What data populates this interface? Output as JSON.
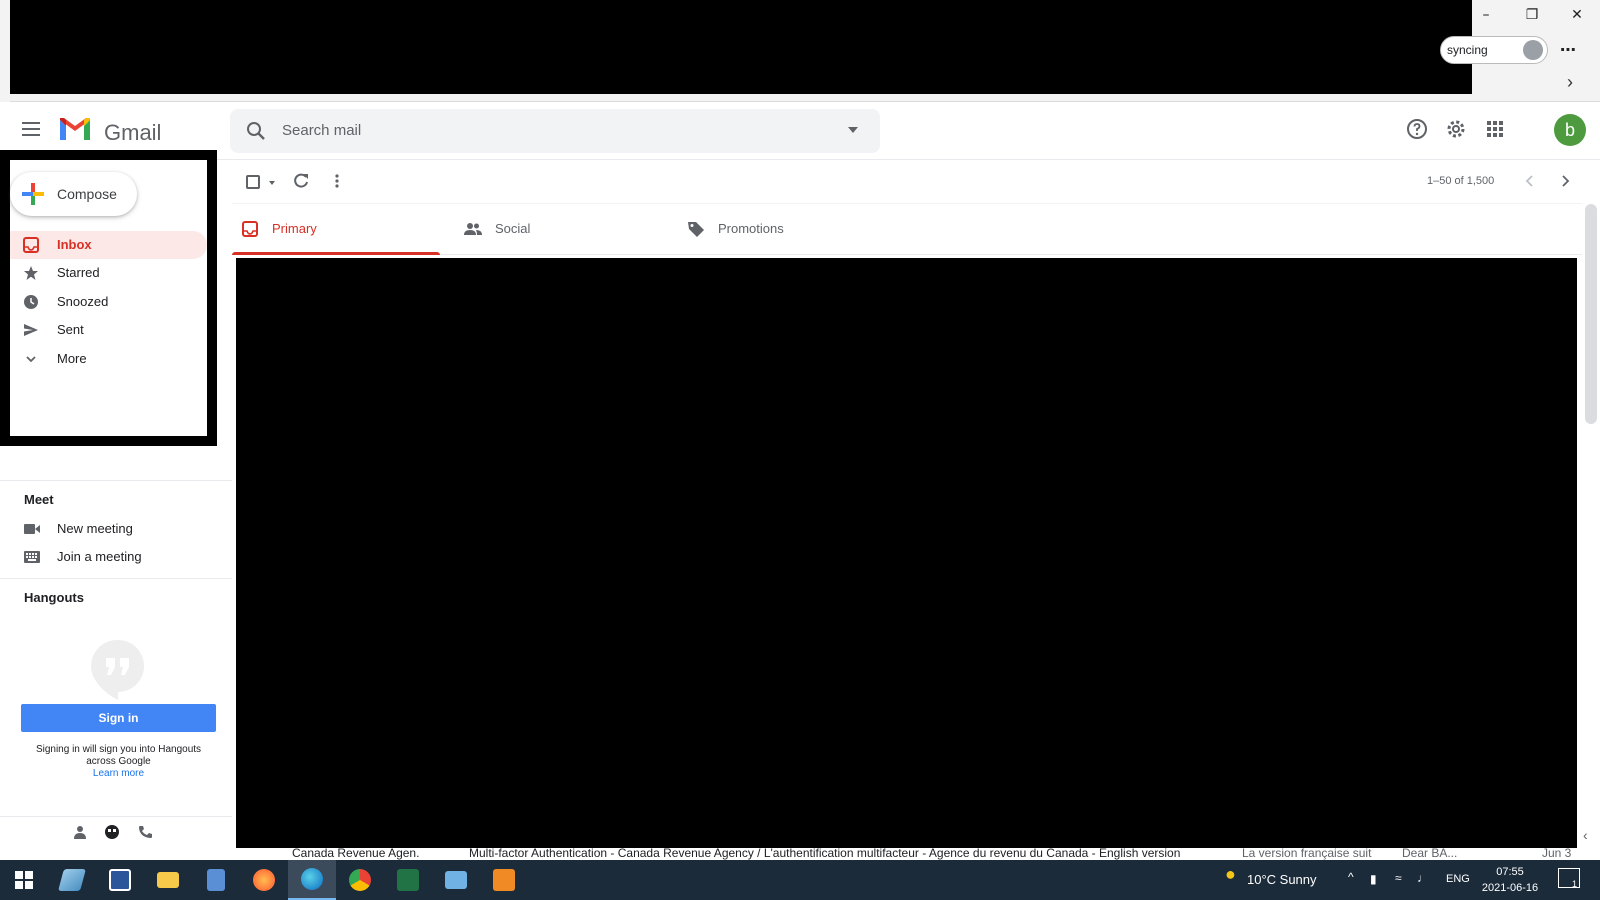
{
  "browser": {
    "sync_label": "syncing",
    "menu_dots": "⋯",
    "next_arrow": "›",
    "window_controls": [
      "–",
      "❐",
      "✕"
    ]
  },
  "header": {
    "app_name": "Gmail",
    "search_placeholder": "Search mail",
    "avatar_letter": "b"
  },
  "nav": {
    "compose_label": "Compose",
    "items": [
      {
        "label": "Inbox",
        "icon": "inbox-icon",
        "active": true
      },
      {
        "label": "Starred",
        "icon": "star-icon"
      },
      {
        "label": "Snoozed",
        "icon": "clock-icon"
      },
      {
        "label": "Sent",
        "icon": "send-icon"
      },
      {
        "label": "More",
        "icon": "chevron-down-icon"
      }
    ]
  },
  "meet": {
    "title": "Meet",
    "items": [
      {
        "label": "New meeting",
        "icon": "video-icon"
      },
      {
        "label": "Join a meeting",
        "icon": "keyboard-icon"
      }
    ]
  },
  "hangouts": {
    "title": "Hangouts",
    "sign_in_label": "Sign in",
    "note": "Signing in will sign you into Hangouts across Google",
    "learn_more": "Learn more"
  },
  "toolbar": {
    "pager_text": "1–50 of 1,500"
  },
  "tabs": [
    {
      "label": "Primary",
      "icon": "inbox-icon",
      "active": true
    },
    {
      "label": "Social",
      "icon": "people-icon"
    },
    {
      "label": "Promotions",
      "icon": "tag-icon"
    }
  ],
  "peek_row": {
    "sender": "Canada Revenue Agen.",
    "subject": "Multi-factor Authentication - Canada Revenue Agency / L'authentification multifacteur - Agence du revenu du Canada - English version",
    "snippet_fr": "La version française suit",
    "snippet_dear": "Dear BA...",
    "date": "Jun 3"
  },
  "taskbar": {
    "weather": "10°C  Sunny",
    "language": "ENG",
    "time": "07:55",
    "date": "2021-06-16",
    "notification_count": "1",
    "colors": {
      "bg": "#1b2b3a",
      "active": "#3b4b5c"
    }
  },
  "colors": {
    "accent_red": "#d93025",
    "active_bg": "#fce8e6",
    "signin_blue": "#4285f4",
    "avatar_green": "#4d9b3e"
  }
}
